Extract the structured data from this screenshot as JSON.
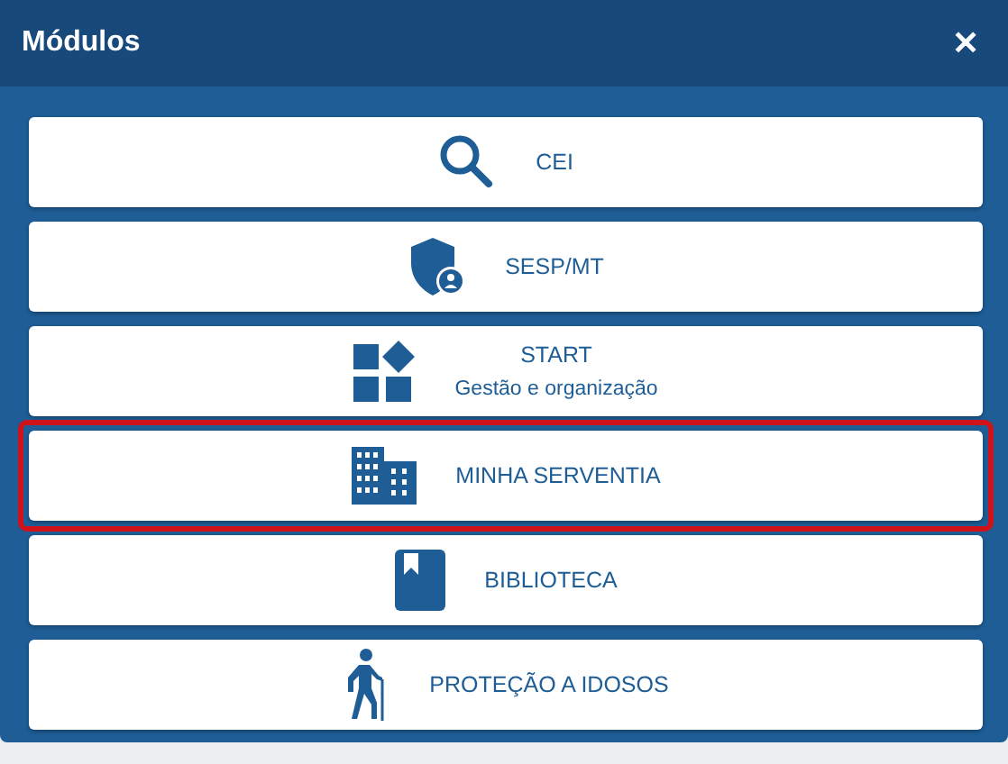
{
  "window": {
    "title": "Módulos",
    "close": "✕"
  },
  "modules": [
    {
      "label": "CEI",
      "highlighted": false
    },
    {
      "label": "SESP/MT",
      "highlighted": false
    },
    {
      "label": "START",
      "subtitle": "Gestão e organização",
      "highlighted": false
    },
    {
      "label": "MINHA SERVENTIA",
      "highlighted": true
    },
    {
      "label": "BIBLIOTECA",
      "highlighted": false
    },
    {
      "label": "PROTEÇÃO A IDOSOS",
      "highlighted": false
    }
  ]
}
